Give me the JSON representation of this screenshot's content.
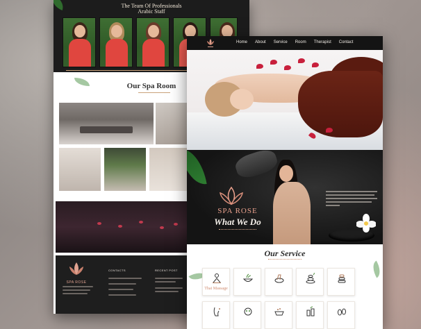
{
  "back_page": {
    "team_title": "The Team Of Professionals",
    "team_subtitle": "Arabic Staff",
    "spa_room_title": "Our Spa Room",
    "footer": {
      "brand": "SPA ROSE",
      "contacts_heading": "CONTACTS",
      "recent_post_heading": "RECENT POST"
    }
  },
  "front_page": {
    "nav": {
      "links": [
        "Home",
        "About",
        "Service",
        "Room",
        "Therapist",
        "Contact"
      ]
    },
    "brand_name": "SPA ROSE",
    "section_heading": "What We Do",
    "service_title": "Our Service",
    "services": [
      {
        "label": "Thai Massage",
        "icon": "massage-person-icon"
      },
      {
        "label": "",
        "icon": "herbal-bowl-icon"
      },
      {
        "label": "",
        "icon": "pedicure-icon"
      },
      {
        "label": "",
        "icon": "hot-stones-icon"
      },
      {
        "label": "",
        "icon": "stacked-stones-icon"
      },
      {
        "label": "",
        "icon": "foot-massage-icon"
      },
      {
        "label": "",
        "icon": "face-mask-icon"
      },
      {
        "label": "",
        "icon": "spa-tub-icon"
      },
      {
        "label": "",
        "icon": "oil-bottles-icon"
      },
      {
        "label": "",
        "icon": "footprints-icon"
      }
    ]
  },
  "colors": {
    "accent": "#c9a27a",
    "brand_pink": "#e8a08c",
    "dark_bg": "#141414"
  }
}
